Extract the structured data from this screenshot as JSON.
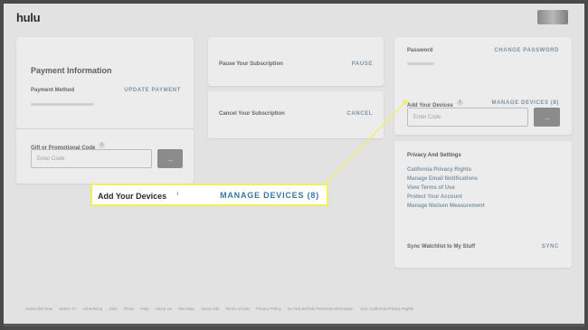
{
  "app": {
    "logo": "hulu"
  },
  "payment": {
    "title": "Payment Information",
    "method_label": "Payment Method",
    "update_link": "UPDATE PAYMENT",
    "gift_label": "Gift or Promotional Code",
    "gift_placeholder": "Enter Code"
  },
  "subscription": {
    "pause_label": "Pause Your Subscription",
    "pause_link": "PAUSE",
    "cancel_label": "Cancel Your Subscription",
    "cancel_link": "CANCEL"
  },
  "account": {
    "password_label": "Password",
    "change_password_link": "CHANGE PASSWORD",
    "devices_label": "Add Your Devices",
    "manage_devices_link": "MANAGE DEVICES (8)",
    "devices_placeholder": "Enter Code"
  },
  "privacy": {
    "title": "Privacy And Settings",
    "links": [
      "California Privacy Rights",
      "Manage Email Notifications",
      "View Terms of Use",
      "Protect Your Account",
      "Manage Nielsen Measurement"
    ],
    "sync_label": "Sync Watchlist to My Stuff",
    "sync_link": "SYNC"
  },
  "callout": {
    "label": "Add Your Devices",
    "link": "MANAGE DEVICES (8)",
    "accent_color": "#f0f05a"
  },
  "footer": {
    "links": [
      "Subscribe Now",
      "Watch Tv",
      "Advertising",
      "Jobs",
      "Press",
      "Help",
      "About Us",
      "Site Map",
      "About Ads",
      "Terms of Use",
      "Privacy Policy",
      "Do Not Sell My Personal Information",
      "Your California Privacy Rights"
    ]
  },
  "icons": {
    "info": "info-icon",
    "arrow": "arrow-right-icon",
    "avatar": "avatar"
  }
}
